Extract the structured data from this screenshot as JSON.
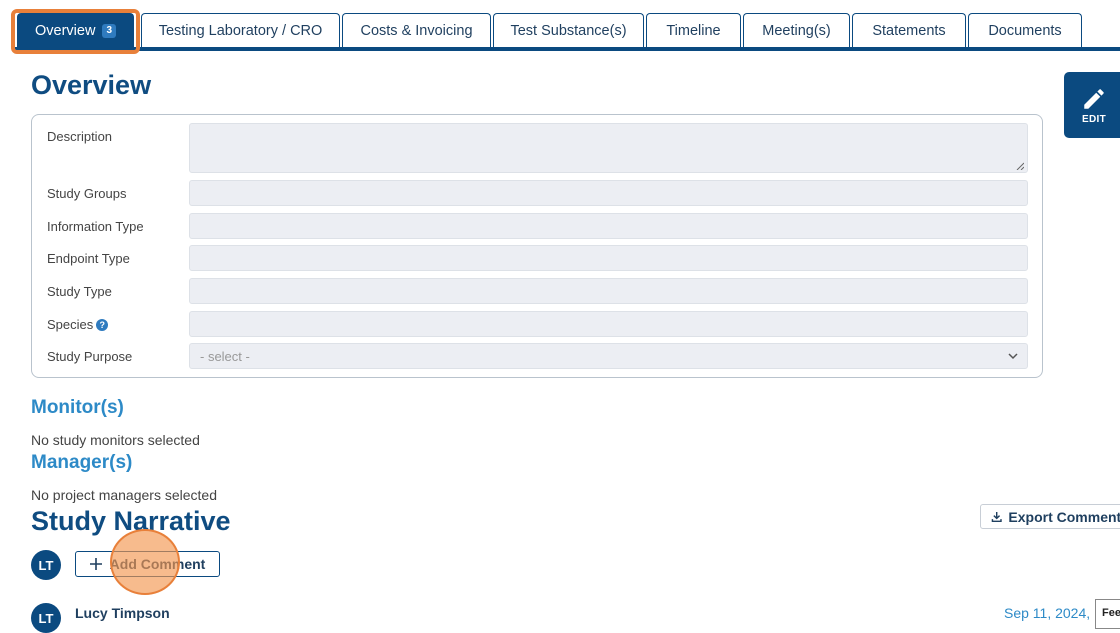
{
  "tabs": [
    {
      "label": "Overview",
      "badge": "3"
    },
    {
      "label": "Testing Laboratory / CRO"
    },
    {
      "label": "Costs & Invoicing"
    },
    {
      "label": "Test Substance(s)"
    },
    {
      "label": "Timeline"
    },
    {
      "label": "Meeting(s)"
    },
    {
      "label": "Statements"
    },
    {
      "label": "Documents"
    }
  ],
  "overview": {
    "title": "Overview",
    "edit_label": "EDIT",
    "fields": {
      "description": {
        "label": "Description",
        "value": ""
      },
      "study_groups": {
        "label": "Study Groups",
        "value": ""
      },
      "information_type": {
        "label": "Information Type",
        "value": ""
      },
      "endpoint_type": {
        "label": "Endpoint Type",
        "value": ""
      },
      "study_type": {
        "label": "Study Type",
        "value": ""
      },
      "species": {
        "label": "Species",
        "value": ""
      },
      "study_purpose": {
        "label": "Study Purpose",
        "value": "- select -"
      }
    }
  },
  "monitors": {
    "title": "Monitor(s)",
    "empty": "No study monitors selected"
  },
  "managers": {
    "title": "Manager(s)",
    "empty": "No project managers selected"
  },
  "narrative": {
    "title": "Study Narrative",
    "export_label": "Export Comments",
    "add_label": "Add Comment",
    "user_initials": "LT",
    "comments": [
      {
        "initials": "LT",
        "author": "Lucy Timpson",
        "date": "Sep 11, 2024,"
      }
    ]
  },
  "feedback_label": "Feedback",
  "colors": {
    "primary": "#0b4a80",
    "accent_highlight": "#e8803a",
    "subheading": "#2d8ac7",
    "field_bg": "#eceef3"
  }
}
